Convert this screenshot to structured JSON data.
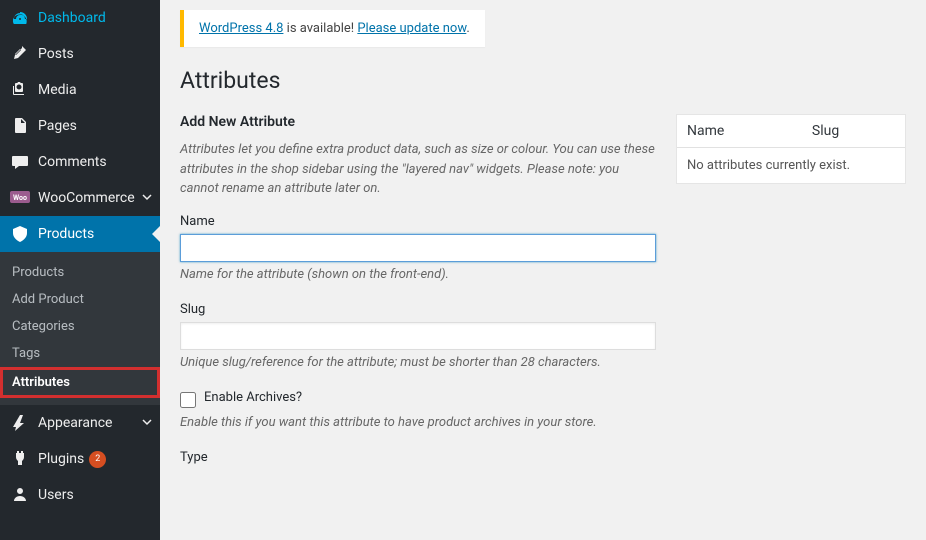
{
  "sidebar": {
    "items": [
      {
        "label": "Dashboard",
        "icon": "dashboard-icon"
      },
      {
        "label": "Posts",
        "icon": "pin-icon"
      },
      {
        "label": "Media",
        "icon": "media-icon"
      },
      {
        "label": "Pages",
        "icon": "page-icon"
      },
      {
        "label": "Comments",
        "icon": "comment-icon"
      },
      {
        "label": "WooCommerce",
        "icon": "woo-icon"
      },
      {
        "label": "Products",
        "icon": "products-icon"
      },
      {
        "label": "Appearance",
        "icon": "appearance-icon"
      },
      {
        "label": "Plugins",
        "icon": "plugins-icon",
        "badge": "2"
      },
      {
        "label": "Users",
        "icon": "users-icon"
      }
    ],
    "submenu": [
      {
        "label": "Products"
      },
      {
        "label": "Add Product"
      },
      {
        "label": "Categories"
      },
      {
        "label": "Tags"
      },
      {
        "label": "Attributes"
      }
    ]
  },
  "notice": {
    "link1": "WordPress 4.8",
    "text1": " is available! ",
    "link2": "Please update now",
    "text2": "."
  },
  "page": {
    "title": "Attributes"
  },
  "form": {
    "section_title": "Add New Attribute",
    "description": "Attributes let you define extra product data, such as size or colour. You can use these attributes in the shop sidebar using the \"layered nav\" widgets. Please note: you cannot rename an attribute later on.",
    "name_label": "Name",
    "name_value": "",
    "name_hint": "Name for the attribute (shown on the front-end).",
    "slug_label": "Slug",
    "slug_value": "",
    "slug_hint": "Unique slug/reference for the attribute; must be shorter than 28 characters.",
    "archives_label": "Enable Archives?",
    "archives_hint": "Enable this if you want this attribute to have product archives in your store.",
    "type_label": "Type"
  },
  "table": {
    "col1": "Name",
    "col2": "Slug",
    "empty": "No attributes currently exist."
  }
}
